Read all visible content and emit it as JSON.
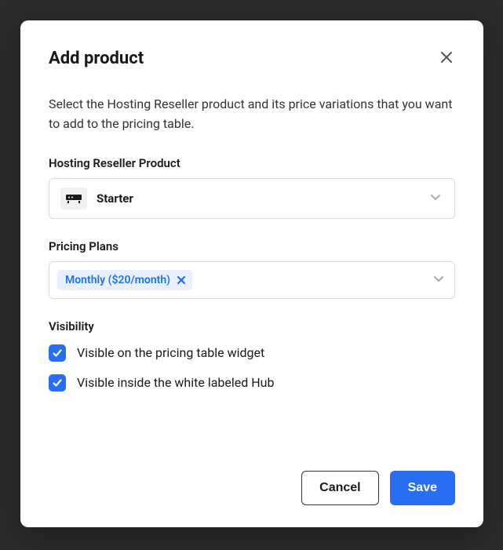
{
  "modal": {
    "title": "Add product",
    "description": "Select the Hosting Reseller product and its price variations that you want to add to the pricing table.",
    "product_select": {
      "label": "Hosting Reseller Product",
      "selected": "Starter"
    },
    "pricing_plans": {
      "label": "Pricing Plans",
      "tags": [
        "Monthly ($20/month)"
      ]
    },
    "visibility": {
      "label": "Visibility",
      "options": [
        {
          "label": "Visible on the pricing table widget",
          "checked": true
        },
        {
          "label": "Visible inside the white labeled Hub",
          "checked": true
        }
      ]
    },
    "actions": {
      "cancel": "Cancel",
      "save": "Save"
    }
  }
}
